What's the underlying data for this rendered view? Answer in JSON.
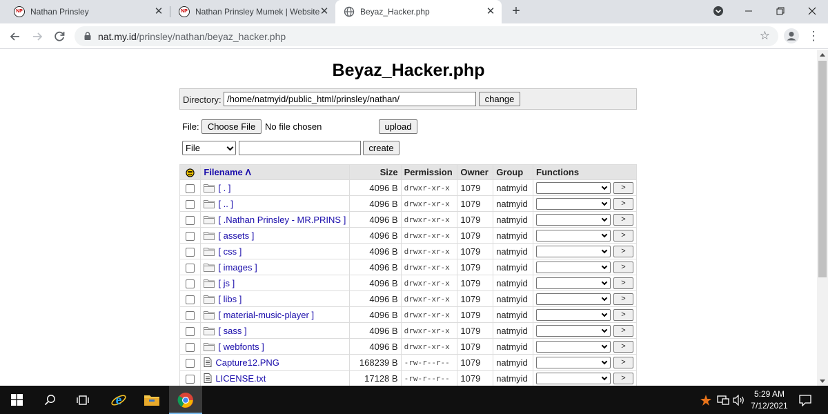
{
  "browser": {
    "tabs": [
      {
        "title": "Nathan Prinsley",
        "close": "✕"
      },
      {
        "title": "Nathan Prinsley Mumek | Website",
        "close": "✕"
      },
      {
        "title": "Beyaz_Hacker.php",
        "close": "✕"
      }
    ],
    "new_tab": "+",
    "url_host": "nat.my.id",
    "url_path": "/prinsley/nathan/beyaz_hacker.php"
  },
  "page": {
    "title": "Beyaz_Hacker.php",
    "directory_label": "Directory:",
    "directory_value": "/home/natmyid/public_html/prinsley/nathan/",
    "change_button": "change",
    "file_label": "File:",
    "choose_file_button": "Choose File",
    "no_file_text": "No file chosen",
    "upload_button": "upload",
    "create_type_value": "File",
    "create_button": "create"
  },
  "table": {
    "headers": {
      "filename": "Filename Λ",
      "size": "Size",
      "permission": "Permission",
      "owner": "Owner",
      "group": "Group",
      "functions": "Functions"
    },
    "go_label": ">",
    "rows": [
      {
        "name": "[ . ]",
        "type": "dir",
        "size": "4096 B",
        "perm": "drwxr-xr-x",
        "owner": "1079",
        "group": "natmyid"
      },
      {
        "name": "[ .. ]",
        "type": "dir",
        "size": "4096 B",
        "perm": "drwxr-xr-x",
        "owner": "1079",
        "group": "natmyid"
      },
      {
        "name": "[ .Nathan Prinsley - MR.PRINS ]",
        "type": "dir",
        "size": "4096 B",
        "perm": "drwxr-xr-x",
        "owner": "1079",
        "group": "natmyid"
      },
      {
        "name": "[ assets ]",
        "type": "dir",
        "size": "4096 B",
        "perm": "drwxr-xr-x",
        "owner": "1079",
        "group": "natmyid"
      },
      {
        "name": "[ css ]",
        "type": "dir",
        "size": "4096 B",
        "perm": "drwxr-xr-x",
        "owner": "1079",
        "group": "natmyid"
      },
      {
        "name": "[ images ]",
        "type": "dir",
        "size": "4096 B",
        "perm": "drwxr-xr-x",
        "owner": "1079",
        "group": "natmyid"
      },
      {
        "name": "[ js ]",
        "type": "dir",
        "size": "4096 B",
        "perm": "drwxr-xr-x",
        "owner": "1079",
        "group": "natmyid"
      },
      {
        "name": "[ libs ]",
        "type": "dir",
        "size": "4096 B",
        "perm": "drwxr-xr-x",
        "owner": "1079",
        "group": "natmyid"
      },
      {
        "name": "[ material-music-player ]",
        "type": "dir",
        "size": "4096 B",
        "perm": "drwxr-xr-x",
        "owner": "1079",
        "group": "natmyid"
      },
      {
        "name": "[ sass ]",
        "type": "dir",
        "size": "4096 B",
        "perm": "drwxr-xr-x",
        "owner": "1079",
        "group": "natmyid"
      },
      {
        "name": "[ webfonts ]",
        "type": "dir",
        "size": "4096 B",
        "perm": "drwxr-xr-x",
        "owner": "1079",
        "group": "natmyid"
      },
      {
        "name": "Capture12.PNG",
        "type": "file",
        "size": "168239 B",
        "perm": "-rw-r--r--",
        "owner": "1079",
        "group": "natmyid"
      },
      {
        "name": "LICENSE.txt",
        "type": "file",
        "size": "17128 B",
        "perm": "-rw-r--r--",
        "owner": "1079",
        "group": "natmyid"
      }
    ]
  },
  "taskbar": {
    "time": "5:29 AM",
    "date": "7/12/2021"
  }
}
